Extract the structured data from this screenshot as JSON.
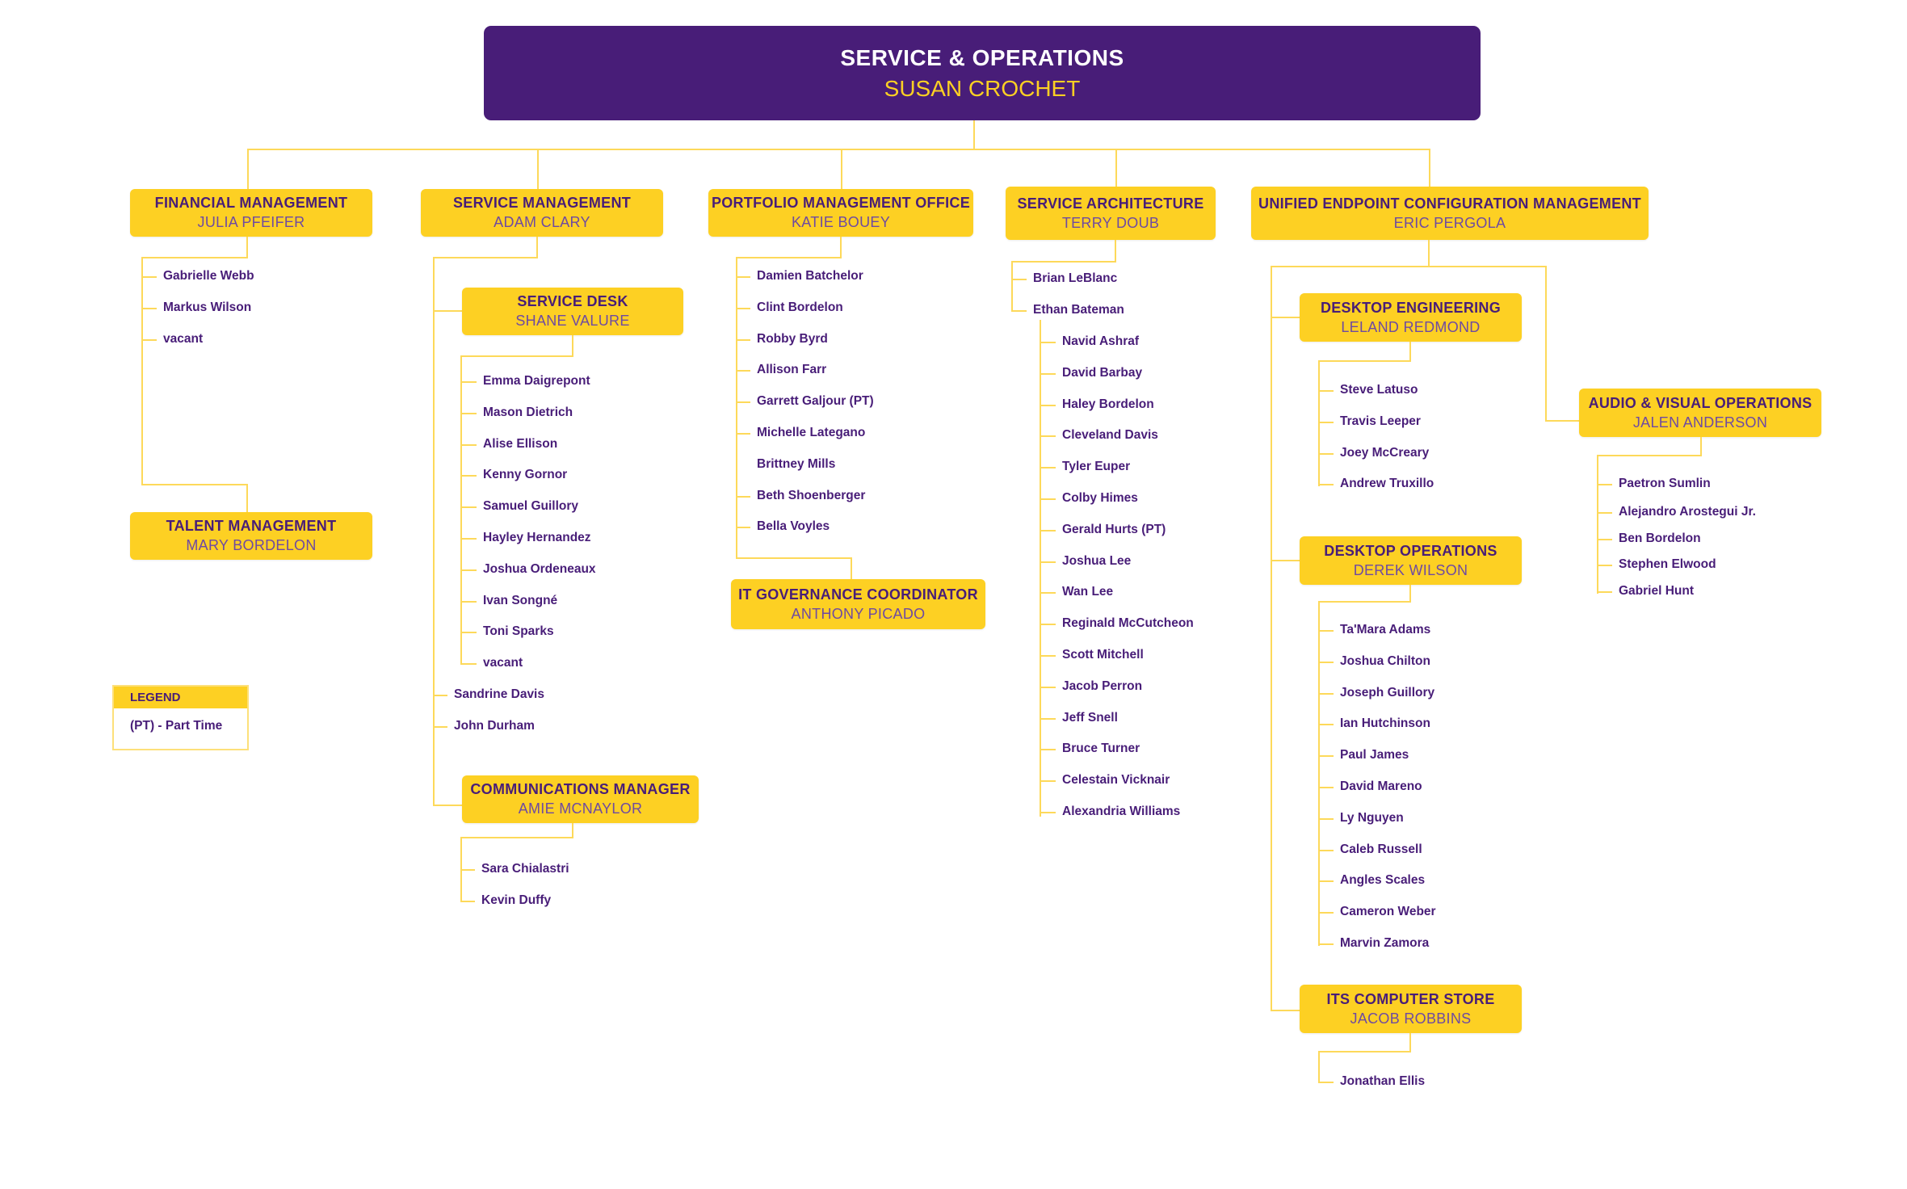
{
  "root": {
    "title": "SERVICE & OPERATIONS",
    "name": "SUSAN CROCHET"
  },
  "colors": {
    "purple": "#481d78",
    "gold": "#fdd023",
    "name_purple": "#6e4aa2",
    "connector": "#fdd95a"
  },
  "units": {
    "financial": {
      "title": "FINANCIAL MANAGEMENT",
      "name": "JULIA PFEIFER",
      "members": [
        "Gabrielle Webb",
        "Markus Wilson",
        "vacant"
      ]
    },
    "talent": {
      "title": "TALENT MANAGEMENT",
      "name": "MARY BORDELON"
    },
    "service_mgmt": {
      "title": "SERVICE MANAGEMENT",
      "name": "ADAM CLARY",
      "members": [
        "Sandrine Davis",
        "John Durham"
      ]
    },
    "service_desk": {
      "title": "SERVICE DESK",
      "name": "SHANE VALURE",
      "members": [
        "Emma Daigrepont",
        "Mason Dietrich",
        "Alise Ellison",
        "Kenny Gornor",
        "Samuel Guillory",
        "Hayley Hernandez",
        "Joshua Ordeneaux",
        "Ivan Songné",
        "Toni Sparks",
        "vacant"
      ]
    },
    "communications": {
      "title": "COMMUNICATIONS MANAGER",
      "name": "AMIE MCNAYLOR",
      "members": [
        "Sara Chialastri",
        "Kevin Duffy"
      ]
    },
    "pmo": {
      "title": "PORTFOLIO MANAGEMENT OFFICE",
      "name": "KATIE BOUEY",
      "members": [
        "Damien Batchelor",
        "Clint Bordelon",
        "Robby Byrd",
        "Allison Farr",
        "Garrett Galjour (PT)",
        "Michelle Lategano",
        "Brittney Mills",
        "Beth Shoenberger",
        "Bella Voyles"
      ]
    },
    "it_governance": {
      "title": "IT GOVERNANCE COORDINATOR",
      "name": "ANTHONY PICADO"
    },
    "architecture": {
      "title": "SERVICE ARCHITECTURE",
      "name": "TERRY DOUB",
      "members": [
        "Brian LeBlanc",
        "Ethan Bateman"
      ],
      "sub_members": [
        "Navid Ashraf",
        "David Barbay",
        "Haley Bordelon",
        "Cleveland Davis",
        "Tyler Euper",
        "Colby Himes",
        "Gerald Hurts (PT)",
        "Joshua Lee",
        "Wan Lee",
        "Reginald McCutcheon",
        "Scott Mitchell",
        "Jacob Perron",
        "Jeff Snell",
        "Bruce Turner",
        "Celestain Vicknair",
        "Alexandria Williams"
      ]
    },
    "uecm": {
      "title": "UNIFIED ENDPOINT CONFIGURATION MANAGEMENT",
      "name": "ERIC PERGOLA"
    },
    "desktop_eng": {
      "title": "DESKTOP ENGINEERING",
      "name": "LELAND REDMOND",
      "members": [
        "Steve Latuso",
        "Travis Leeper",
        "Joey McCreary",
        "Andrew Truxillo"
      ]
    },
    "desktop_ops": {
      "title": "DESKTOP OPERATIONS",
      "name": "DEREK WILSON",
      "members": [
        "Ta'Mara Adams",
        "Joshua Chilton",
        "Joseph Guillory",
        "Ian Hutchinson",
        "Paul James",
        "David Mareno",
        "Ly Nguyen",
        "Caleb Russell",
        "Angles Scales",
        "Cameron Weber",
        "Marvin Zamora"
      ]
    },
    "computer_store": {
      "title": "ITS COMPUTER STORE",
      "name": "JACOB ROBBINS",
      "members": [
        "Jonathan Ellis"
      ]
    },
    "av_ops": {
      "title": "AUDIO & VISUAL OPERATIONS",
      "name": "JALEN ANDERSON",
      "members": [
        "Paetron Sumlin",
        "Alejandro Arostegui Jr.",
        "Ben Bordelon",
        "Stephen Elwood",
        "Gabriel Hunt"
      ]
    }
  },
  "legend": {
    "title": "LEGEND",
    "items": [
      "(PT) - Part Time"
    ]
  }
}
